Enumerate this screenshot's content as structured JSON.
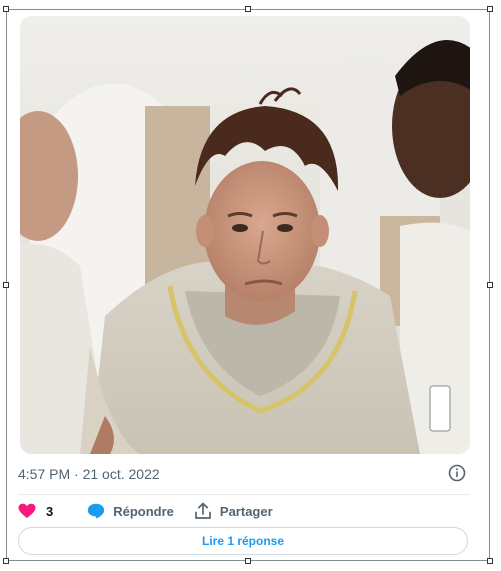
{
  "tweet": {
    "timestamp": "4:57 PM · 21 oct. 2022",
    "likes_count": "3",
    "reply_label": "Répondre",
    "share_label": "Partager",
    "read_replies_label": "Lire 1 réponse"
  },
  "icons": {
    "info": "info-icon",
    "like": "heart-icon",
    "reply": "speech-bubble-icon",
    "share": "share-upload-icon"
  },
  "colors": {
    "like": "#f91880",
    "reply": "#1d9bf0",
    "link": "#1d9bf0",
    "muted_text": "#536471"
  }
}
